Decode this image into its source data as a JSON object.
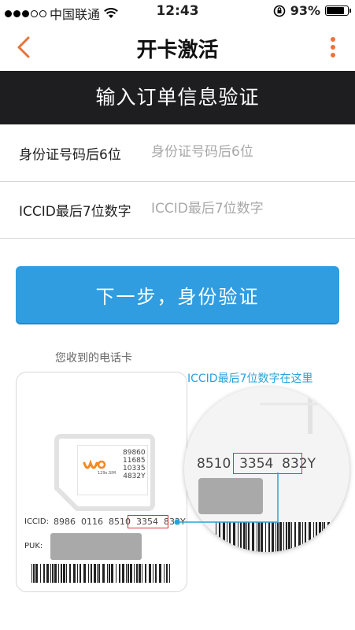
{
  "status_bar": {
    "carrier": "中国联通",
    "time": "12:43",
    "battery_percent": "93%",
    "battery_level": 0.93,
    "signal_dots_filled": 3,
    "signal_dots_total": 5,
    "icons": [
      "signal-dots-icon",
      "wifi-icon",
      "rotation-lock-icon",
      "battery-icon"
    ]
  },
  "nav": {
    "title": "开卡激活",
    "back_icon": "chevron-left-icon",
    "more_icon": "more-vertical-icon",
    "accent_color": "#e9733a"
  },
  "banner": {
    "text": "输入订单信息验证"
  },
  "form": {
    "id_label": "身份证号码后6位",
    "id_placeholder": "身份证号码后6位",
    "iccid_label": "ICCID最后7位数字",
    "iccid_placeholder": "ICCID最后7位数字"
  },
  "next_button": {
    "label": "下一步，身份验证",
    "color": "#2f9de0"
  },
  "illustration": {
    "card_caption": "您收到的电话卡",
    "hint": "ICCID最后7位数字在这里",
    "hint_color": "#2aa2d9",
    "highlight_color": "#d33333",
    "chip_lines": [
      "89860",
      "11685",
      "10335",
      "4832Y"
    ],
    "logo_text": "129x.SIM",
    "iccid_label": "ICCID:",
    "iccid_prefix": "8986  0116  8510",
    "iccid_highlight": "3354  832Y",
    "puk_label": "PUK:",
    "zoom_prefix": "8510",
    "zoom_highlight": "3354  832",
    "zoom_suffix": "Y"
  }
}
